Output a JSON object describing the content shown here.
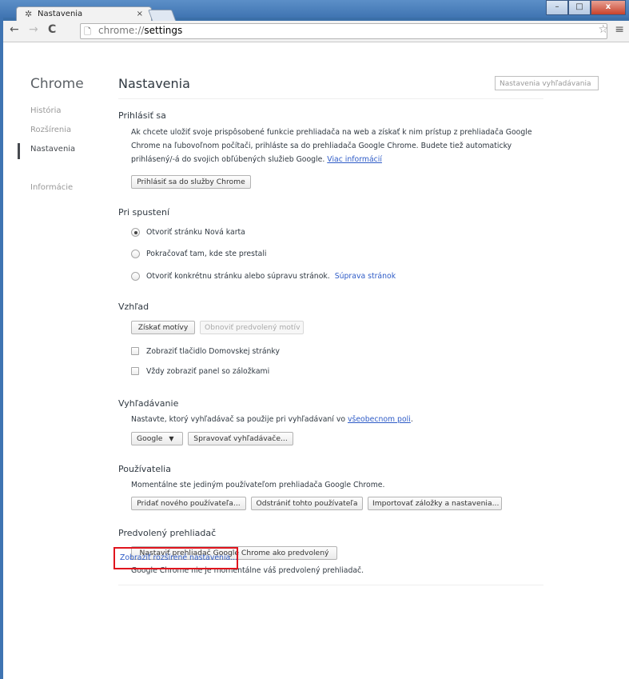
{
  "window": {
    "tab_title": "Nastavenia",
    "tab_close": "×",
    "controls": {
      "minimize": "–",
      "maximize": "□",
      "close": "x"
    }
  },
  "toolbar": {
    "url_prefix": "chrome://",
    "url_path": "settings"
  },
  "sidebar": {
    "title": "Chrome",
    "items": [
      {
        "label": "História"
      },
      {
        "label": "Rozšírenia"
      },
      {
        "label": "Nastavenia"
      },
      {
        "label": "Informácie"
      }
    ]
  },
  "main": {
    "title": "Nastavenia",
    "search_placeholder": "Nastavenia vyhľadávania",
    "signin": {
      "title": "Prihlásiť sa",
      "line1": "Ak chcete uložiť svoje prispôsobené funkcie prehliadača na web a získať k nim prístup z prehliadača Google",
      "line2": "Chrome na ľubovoľnom počítači, prihláste sa do prehliadača Google Chrome. Budete tiež automaticky",
      "line3": "prihlásený/-á do svojich obľúbených služieb Google.",
      "more_link": "Viac informácií",
      "button": "Prihlásiť sa do služby Chrome"
    },
    "startup": {
      "title": "Pri spustení",
      "options": [
        {
          "label": "Otvoriť stránku Nová karta",
          "selected": true
        },
        {
          "label": "Pokračovať tam, kde ste prestali",
          "selected": false
        },
        {
          "label": "Otvoriť konkrétnu stránku alebo súpravu stránok.",
          "selected": false
        }
      ],
      "pages_link": "Súprava stránok"
    },
    "appearance": {
      "title": "Vzhľad",
      "get_themes": "Získať motívy",
      "reset_theme": "Obnoviť predvolený motív",
      "show_home": "Zobraziť tlačidlo Domovskej stránky",
      "show_bookmarks": "Vždy zobraziť panel so záložkami"
    },
    "search": {
      "title": "Vyhľadávanie",
      "text": "Nastavte, ktorý vyhľadávač sa použije pri vyhľadávaní vo",
      "link": "všeobecnom poli",
      "period": ".",
      "engine": "Google",
      "manage": "Spravovať vyhľadávače..."
    },
    "users": {
      "title": "Používatelia",
      "text": "Momentálne ste jediným používateľom prehliadača Google Chrome.",
      "add": "Pridať nového používateľa...",
      "remove": "Odstrániť tohto používateľa",
      "import": "Importovať záložky a nastavenia..."
    },
    "default_browser": {
      "title": "Predvolený prehliadač",
      "button": "Nastaviť prehliadač Google Chrome ako predvolený",
      "text": "Google Chrome nie je momentálne váš predvolený prehliadač."
    },
    "advanced_link": "Zobraziť rozšírené nastavenia..."
  }
}
